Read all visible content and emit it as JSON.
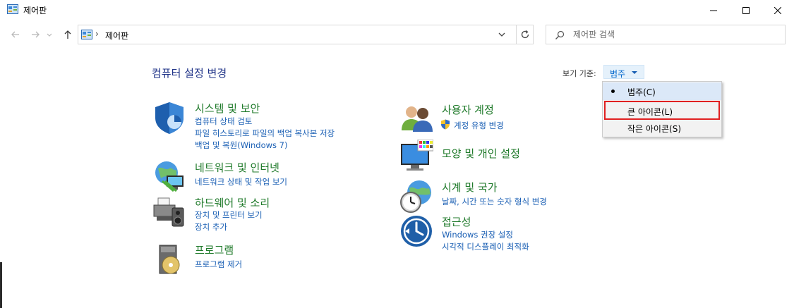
{
  "window": {
    "title": "제어판"
  },
  "address": {
    "crumb": "제어판"
  },
  "search": {
    "placeholder": "제어판 검색"
  },
  "heading": "컴퓨터 설정 변경",
  "viewby": {
    "label": "보기 기준:",
    "value": "범주"
  },
  "menu": {
    "items": [
      {
        "label": "범주(C)",
        "selected": true
      },
      {
        "label": "큰 아이콘(L)",
        "highlighted": true
      },
      {
        "label": "작은 아이콘(S)"
      }
    ]
  },
  "categories": [
    {
      "title": "시스템 및 보안",
      "icon": "shield-icon",
      "links": [
        "컴퓨터 상태 검토",
        "파일 히스토리로 파일의 백업 복사본 저장",
        "백업 및 복원(Windows 7)"
      ]
    },
    {
      "title": "네트워크 및 인터넷",
      "icon": "network-globe-icon",
      "links": [
        "네트워크 상태 및 작업 보기"
      ]
    },
    {
      "title": "하드웨어 및 소리",
      "icon": "printer-speaker-icon",
      "links": [
        "장치 및 프린터 보기",
        "장치 추가"
      ]
    },
    {
      "title": "프로그램",
      "icon": "program-disc-icon",
      "links": [
        "프로그램 제거"
      ]
    },
    {
      "title": "사용자 계정",
      "icon": "users-icon",
      "links": [
        "계정 유형 변경"
      ]
    },
    {
      "title": "모양 및 개인 설정",
      "icon": "monitor-palette-icon",
      "links": []
    },
    {
      "title": "시계 및 국가",
      "icon": "clock-globe-icon",
      "links": [
        "날짜, 시간 또는 숫자 형식 변경"
      ]
    },
    {
      "title": "접근성",
      "icon": "ease-of-access-icon",
      "links": [
        "Windows 권장 설정",
        "시각적 디스플레이 최적화"
      ]
    }
  ],
  "colors": {
    "title_green": "#1f7a2a",
    "link_blue": "#1a5fb4",
    "heading_blue": "#1e3287",
    "highlight_red": "#e02020"
  }
}
